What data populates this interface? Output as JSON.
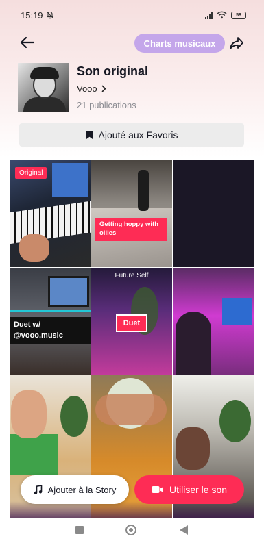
{
  "status_bar": {
    "time": "15:19",
    "battery": "58"
  },
  "header": {
    "charts_label": "Charts musicaux"
  },
  "sound": {
    "title": "Son original",
    "artist": "Vooo",
    "publications": "21 publications"
  },
  "favorites": {
    "label": "Ajouté aux Favoris"
  },
  "videos": {
    "original_badge": "Original",
    "v2_caption": "Getting hoppy with ollies",
    "v4_caption": "Duet w/ @vooo.music",
    "v5_title": "Future Self",
    "v5_badge": "Duet"
  },
  "actions": {
    "story_label": "Ajouter à la Story",
    "use_sound_label": "Utiliser le son"
  },
  "colors": {
    "accent_red": "#fe2c55",
    "charts_purple": "#c4a6ea"
  }
}
